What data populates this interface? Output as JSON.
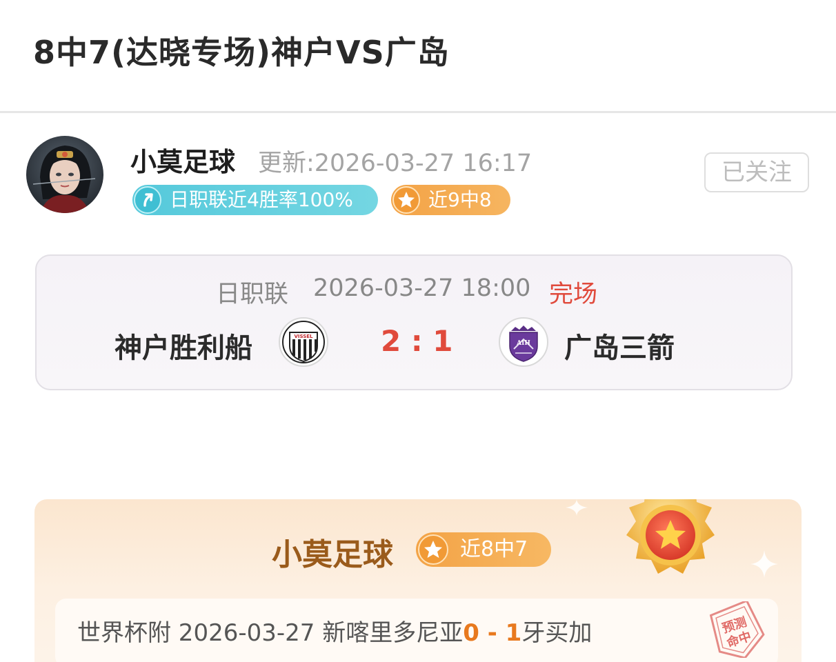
{
  "header": {
    "title": "8中7(达晓专场)神户VS广岛"
  },
  "author": {
    "name": "小莫足球",
    "update_time": "更新:2026-03-27 16:17",
    "follow_label": "已关注",
    "badges": [
      {
        "text": "日职联近4胜率100%",
        "icon": "arrow-up-icon",
        "color": "#55c9db"
      },
      {
        "text": "近9中8",
        "icon": "star-icon",
        "color": "#f3a346"
      }
    ]
  },
  "match": {
    "league": "日职联",
    "datetime": "2026-03-27 18:00",
    "status": "完场",
    "home_team": "神户胜利船",
    "away_team": "广岛三箭",
    "score": "2 : 1",
    "home_logo_text": "VISSEL",
    "away_logo_text": "AIH"
  },
  "promo": {
    "name": "小莫足球",
    "record_badge": "近8中7",
    "history": {
      "prefix": "世界杯附 2026-03-27 新喀里多尼亚",
      "score": "0 - 1",
      "suffix": "牙买加"
    },
    "stamp_text": [
      "预测",
      "命中"
    ]
  },
  "colors": {
    "accent_red": "#e04a3c",
    "teal": "#55c9db",
    "orange": "#f3a346",
    "brown": "#9a5b1b"
  }
}
